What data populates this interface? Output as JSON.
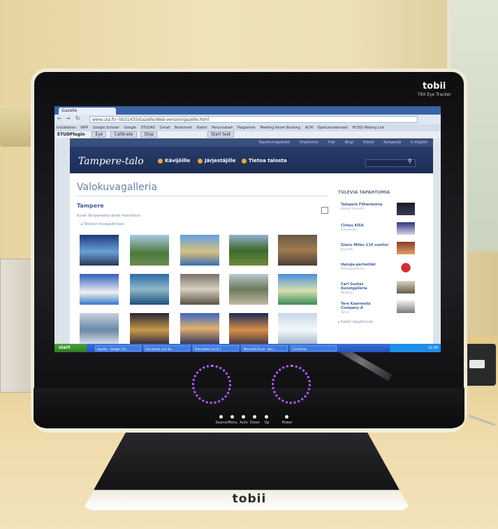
{
  "monitor": {
    "brand_top": "tobii",
    "brand_top_sub": "T60 Eye Tracker",
    "brand_base": "tobii",
    "buttons": [
      "Source",
      "Menu",
      "Auto",
      "Down",
      "Up",
      "Power"
    ]
  },
  "browser": {
    "tab_title": "Gazelle",
    "url": "www.uta.fi/~kb31435/Gazelle/Web-version/gazelle.html",
    "bookmarks": [
      "Installation",
      "WPP",
      "Google Scholar",
      "Google",
      "STGDAS",
      "Gmail",
      "Bookmark",
      "Kaikki",
      "Peruutukset",
      "Plagiarism",
      "Meeting Room Booking",
      "ACM",
      "Opetusmateriaali",
      "HCISD Mailing List"
    ],
    "toolbar_label": "ETUDPlugin",
    "toolbar_buttons": [
      "Eye",
      "Calibrate",
      "Stop",
      "Start test"
    ]
  },
  "site": {
    "top_links": [
      "Tapahtumapaketit",
      "Ohjelmisto",
      "Tilat",
      "Blogi",
      "Videot",
      "Kampanja",
      "in English"
    ],
    "logo": "Tampere-talo",
    "nav": [
      "Kävijöille",
      "Järjestäjille",
      "Tietoa talosta"
    ],
    "gallery_title": "Valokuvagalleria",
    "section_title": "Tampere",
    "description": "Kuvat Tampereelta lähde mainittava",
    "back_link": "Takaisin kuvagalleriaan",
    "sidebar_title": "TULEVIA TAPAHTUMIA",
    "events": [
      {
        "title": "Tampere Filharmonia",
        "sub": "Kevään konsertti"
      },
      {
        "title": "Cirkus KISA",
        "sub": "Sirkusesitys"
      },
      {
        "title": "Glenn Miller 110 vuotta!",
        "sub": "Konsertti"
      },
      {
        "title": "Hanuja-perhetilat",
        "sub": "Perhetapahtuma"
      },
      {
        "title": "Carl Gustav Kunstgalleria",
        "sub": "Näyttely"
      },
      {
        "title": "Tere Kaarnesta Company A",
        "sub": "Tanssi"
      }
    ],
    "all_events": "Kaikki tapahtumat"
  },
  "taskbar": {
    "start": "start",
    "tasks": [
      "Gazelle - Google Chr...",
      "Document and Se...",
      "Kalevatalo Gal (E:)",
      "Microsoft Excel - Boo...",
      "ClearView"
    ],
    "clock": "12:58"
  }
}
